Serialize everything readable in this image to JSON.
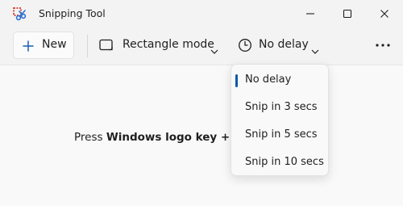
{
  "window": {
    "title": "Snipping Tool",
    "icon": "snipping-tool-icon",
    "controls": [
      "minimize-icon",
      "maximize-icon",
      "close-icon"
    ]
  },
  "toolbar": {
    "new_label": "New",
    "mode_label": "Rectangle mode",
    "delay_label": "No delay",
    "more_icon": "more-horizontal-icon"
  },
  "content": {
    "hint_prefix": "Press ",
    "hint_bold": "Windows logo key + Shif"
  },
  "delay_menu": {
    "selected_index": 0,
    "items": [
      {
        "label": "No delay"
      },
      {
        "label": "Snip in 3 secs"
      },
      {
        "label": "Snip in 5 secs"
      },
      {
        "label": "Snip in 10 secs"
      }
    ]
  },
  "colors": {
    "accent": "#0f5aa8",
    "background": "#f3f3f3",
    "icon_red": "#d33a2f",
    "icon_blue": "#2b6fd1"
  }
}
